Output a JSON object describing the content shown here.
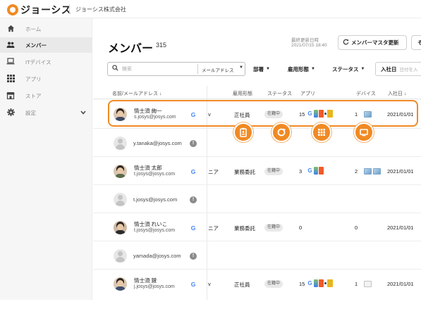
{
  "brand": {
    "name": "ジョーシス",
    "company": "ジョーシス株式会社",
    "accent": "#f08a24"
  },
  "sidebar": {
    "items": [
      {
        "label": "ホーム",
        "icon": "home-icon"
      },
      {
        "label": "メンバー",
        "icon": "people-icon",
        "active": true
      },
      {
        "label": "ITデバイス",
        "icon": "laptop-icon"
      },
      {
        "label": "アプリ",
        "icon": "apps-grid-icon"
      },
      {
        "label": "ストア",
        "icon": "store-icon"
      },
      {
        "label": "設定",
        "icon": "gear-icon"
      }
    ]
  },
  "header": {
    "title": "メンバー",
    "count": "315",
    "last_update_label": "最終更新日時",
    "last_update_value": "2021/07/15 18:40",
    "master_update_button": "メンバーマスタ更新",
    "cut_button": "そ"
  },
  "filters": {
    "search_placeholder": "検索",
    "search_scope": "メールアドレス",
    "department": "部署",
    "employment_type": "雇用形態",
    "status": "ステータス",
    "join_date": "入社日",
    "join_date_placeholder": "日付を入"
  },
  "table": {
    "headers": {
      "name_email": "名前/メールアドレス ↓",
      "employment_type": "雇用形態",
      "status": "ステータス",
      "apps": "アプリ",
      "devices": "デバイス",
      "join_date": "入社日 ↓"
    },
    "rows": [
      {
        "name": "情士須 絢一",
        "email": "s.josys@josys.com",
        "role_partial": "v",
        "employment": "正社員",
        "status": "在籍中",
        "apps": "15",
        "devices": "1",
        "join_date": "2021/01/01"
      },
      {
        "email": "y.tanaka@josys.com"
      },
      {
        "name": "情士須 太郎",
        "email": "t.josys@josys.com",
        "role_partial": "ニア",
        "employment": "業務委託",
        "status": "在籍中",
        "apps": "3",
        "devices": "2",
        "join_date": "2021/01/01"
      },
      {
        "email": "t.josys@josys.com"
      },
      {
        "name": "情士須 れいこ",
        "email": "t.josys@josys.com",
        "role_partial": "ニア",
        "employment": "業務委託",
        "status": "在籍中",
        "apps": "0",
        "devices": "0",
        "join_date": "2021/01/01"
      },
      {
        "email": "yamada@josys.com"
      },
      {
        "name": "情士須 鐙",
        "email": "j.josys@josys.com",
        "role_partial": "v",
        "employment": "正社員",
        "status": "在籍中",
        "apps": "15",
        "devices": "1",
        "join_date": "2021/01/01"
      }
    ]
  },
  "overlay": {
    "icons": [
      "badge-icon",
      "sync-icon",
      "apps-grid-icon",
      "monitor-icon"
    ]
  }
}
